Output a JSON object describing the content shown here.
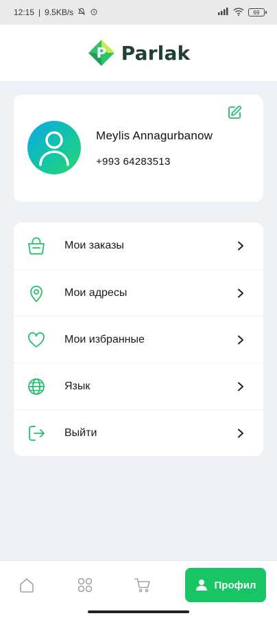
{
  "status_bar": {
    "time": "12:15",
    "network_speed": "9.5KB/s",
    "battery": "69"
  },
  "header": {
    "logo_letter": "P",
    "app_name": "Parlak"
  },
  "profile": {
    "name": "Meylis Annagurbanow",
    "phone": "+993 64283513"
  },
  "menu": {
    "items": [
      {
        "label": "Мои заказы",
        "icon": "shopping-basket-icon"
      },
      {
        "label": "Мои адресы",
        "icon": "location-pin-icon"
      },
      {
        "label": "Мои избранные",
        "icon": "heart-icon"
      },
      {
        "label": "Язык",
        "icon": "globe-icon"
      },
      {
        "label": "Выйти",
        "icon": "logout-icon"
      }
    ]
  },
  "bottom_nav": {
    "profile_label": "Профил"
  },
  "colors": {
    "accent": "#18c464",
    "icon_green": "#1fbf6c",
    "background": "#eef2f6"
  }
}
